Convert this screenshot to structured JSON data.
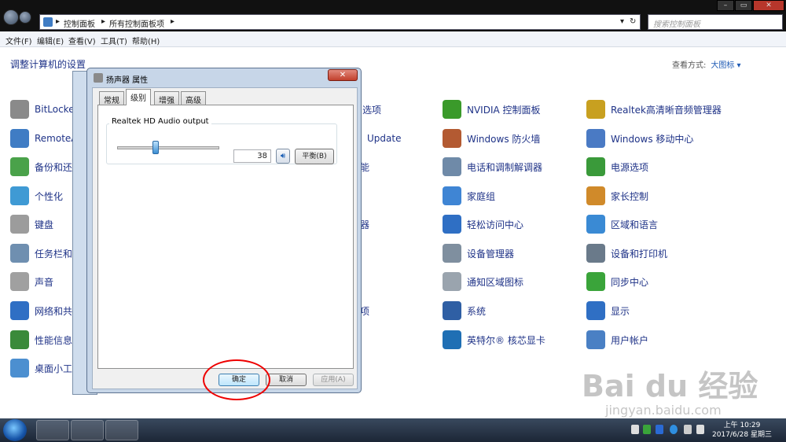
{
  "address_bar": {
    "segments": [
      "控制面板",
      "所有控制面板项"
    ],
    "sep": "▸"
  },
  "search": {
    "placeholder": "搜索控制面板"
  },
  "window_buttons": {
    "minimize": "–",
    "maximize": "▭",
    "close": "✕"
  },
  "menu": [
    "文件(F)",
    "编辑(E)",
    "查看(V)",
    "工具(T)",
    "帮助(H)"
  ],
  "heading": "调整计算机的设置",
  "view_by": {
    "label": "查看方式:",
    "value": "大图标 ▾"
  },
  "items": {
    "col1": [
      "BitLocke",
      "RemoteA",
      "备份和还",
      "个性化",
      "键盘",
      "任务栏和",
      "声音",
      "网络和共",
      "性能信息",
      "桌面小工"
    ],
    "col2": [
      "选项",
      "Update",
      "能",
      "器",
      "项"
    ],
    "col3": [
      "NVIDIA 控制面板",
      "Windows 防火墙",
      "电话和调制解调器",
      "家庭组",
      "轻松访问中心",
      "设备管理器",
      "通知区域图标",
      "系统",
      "英特尔® 核芯显卡"
    ],
    "col4": [
      "Realtek高清晰音频管理器",
      "Windows 移动中心",
      "电源选项",
      "家长控制",
      "区域和语言",
      "设备和打印机",
      "同步中心",
      "显示",
      "用户帐户"
    ]
  },
  "icon_colors": {
    "col1": [
      "#8a8a8a",
      "#3f7cc4",
      "#4aa24a",
      "#3f9ad4",
      "#9c9c9c",
      "#6f8fb0",
      "#a0a0a0",
      "#2f6fc4",
      "#3a8a3a",
      "#4c8fd0"
    ],
    "col3": [
      "#3a9a2a",
      "#b35a32",
      "#6f8aa8",
      "#3f85d4",
      "#2f6fc4",
      "#7f8f9f",
      "#9aa4ae",
      "#2f5fa4",
      "#1f6fb4"
    ],
    "col4": [
      "#c8a020",
      "#4a7ac4",
      "#3a9a3a",
      "#d08a2a",
      "#3a8ad4",
      "#6a7a8a",
      "#3aa43a",
      "#2f6fc4",
      "#4a80c4"
    ]
  },
  "dialog": {
    "title": "扬声器 属性",
    "close_label": "✕",
    "tabs": [
      "常规",
      "级别",
      "增强",
      "高级"
    ],
    "active_tab": "级别",
    "group_label": "Realtek HD Audio output",
    "volume": 38,
    "speaker_icon": "speaker-icon",
    "balance_label": "平衡(B)",
    "ok_label": "确定",
    "cancel_label": "取消",
    "apply_label": "应用(A)"
  },
  "watermark": {
    "text": "Bai du 经验",
    "url": "jingyan.baidu.com"
  },
  "clock": {
    "time": "上午 10:29",
    "date": "2017/6/28 星期三"
  }
}
